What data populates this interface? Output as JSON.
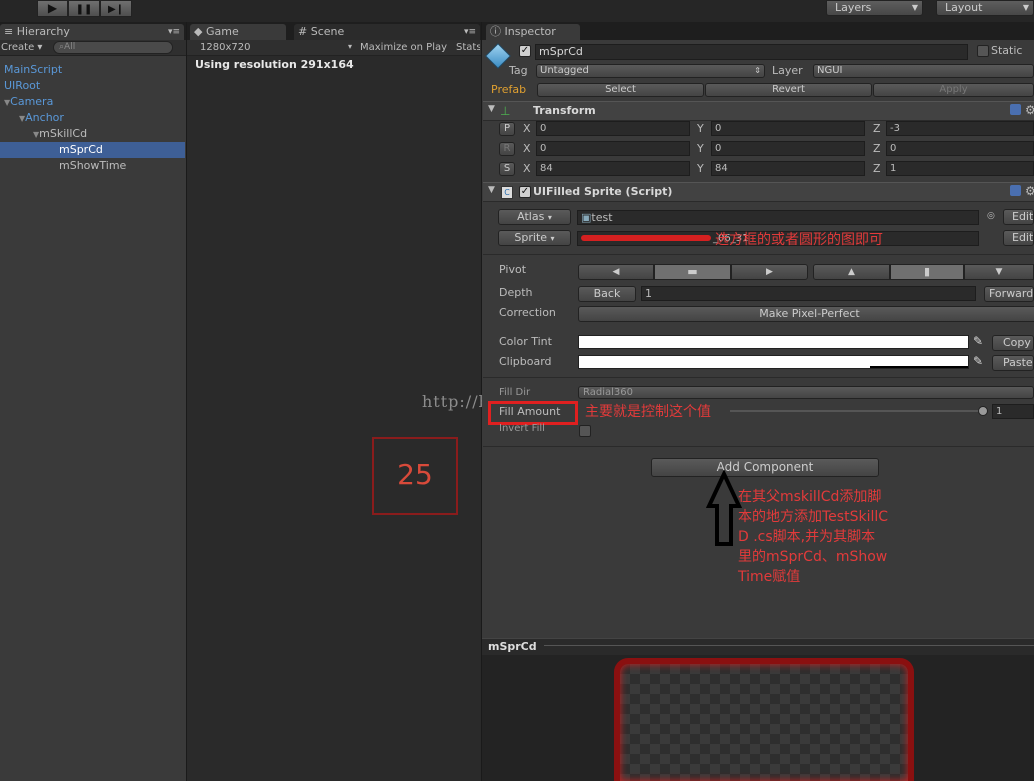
{
  "topbar": {
    "play_icon": "▶",
    "pause_icon": "❚❚",
    "step_icon": "▶❙",
    "layers_label": "Layers",
    "layout_label": "Layout"
  },
  "hierarchy": {
    "tab_label": "Hierarchy",
    "create_label": "Create",
    "search_placeholder": "All",
    "items": [
      {
        "label": "MainScript"
      },
      {
        "label": "UIRoot"
      },
      {
        "label": "Camera"
      },
      {
        "label": "Anchor"
      },
      {
        "label": "mSkillCd"
      },
      {
        "label": "mSprCd"
      },
      {
        "label": "mShowTime"
      }
    ]
  },
  "game": {
    "tab_label": "Game",
    "scene_tab_label": "Scene",
    "resolution_select": "1280x720",
    "maximize_label": "Maximize on Play",
    "stats_label": "Stats",
    "using_resolution": "Using resolution 291x164",
    "countdown": "25",
    "watermark": "http://blog.csdn.net/"
  },
  "inspector": {
    "tab_label": "Inspector",
    "object_name": "mSprCd",
    "static_label": "Static",
    "tag_label": "Tag",
    "tag_value": "Untagged",
    "layer_label": "Layer",
    "layer_value": "NGUI",
    "prefab_label": "Prefab",
    "select_label": "Select",
    "revert_label": "Revert",
    "apply_label": "Apply",
    "transform": {
      "title": "Transform",
      "p_label": "P",
      "r_label": "R",
      "s_label": "S",
      "x_label": "X",
      "y_label": "Y",
      "z_label": "Z",
      "position": [
        "0",
        "0",
        "-3"
      ],
      "rotation": [
        "0",
        "0",
        "0"
      ],
      "scale": [
        "84",
        "84",
        "1"
      ]
    },
    "sprite": {
      "title": "UIFilled Sprite (Script)",
      "atlas_label": "Atlas",
      "atlas_value": "test",
      "edit_label": "Edit",
      "sprite_label": "Sprite",
      "sprite_value": "_06_31",
      "pivot_label": "Pivot",
      "depth_label": "Depth",
      "back_label": "Back",
      "depth_value": "1",
      "forward_label": "Forward",
      "correction_label": "Correction",
      "make_pixel_label": "Make Pixel-Perfect",
      "color_tint_label": "Color Tint",
      "copy_label": "Copy",
      "clipboard_label": "Clipboard",
      "paste_label": "Paste",
      "fill_dir_label": "Fill Dir",
      "fill_dir_value": "Radial360",
      "fill_amount_label": "Fill Amount",
      "fill_amount_value": "1",
      "invert_fill_label": "Invert Fill"
    },
    "add_component_label": "Add Component",
    "preview_label": "mSprCd"
  },
  "annotations": {
    "sprite_note": "选方框的或者圆形的图即可",
    "fill_note": "主要就是控制这个值",
    "add_note": "在其父mskillCd添加脚本的地方添加TestSkillCD .cs脚本,并为其脚本里的mSprCd、mShowTime赋值"
  },
  "colors": {
    "hierarchy_link": "#5a98d8",
    "selected_row": "#3e5f96",
    "annotation_red": "#e23a3a",
    "prefab_orange": "#e0a030"
  }
}
